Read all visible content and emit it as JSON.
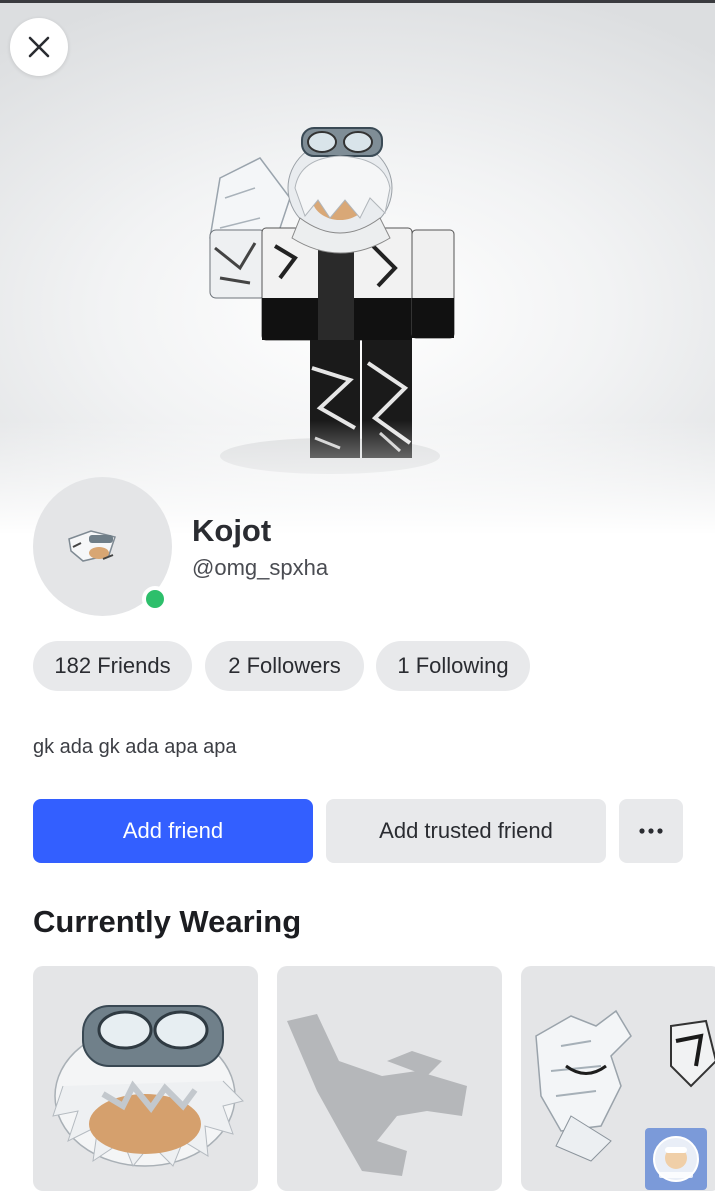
{
  "profile": {
    "display_name": "Kojot",
    "username": "@omg_spxha",
    "online": true,
    "bio": "gk ada gk ada apa apa"
  },
  "stats": {
    "friends": "182 Friends",
    "followers": "2 Followers",
    "following": "1 Following"
  },
  "actions": {
    "add_friend": "Add friend",
    "add_trusted_friend": "Add trusted friend",
    "more": "···"
  },
  "currently_wearing": {
    "title": "Currently Wearing",
    "items": [
      {
        "icon": "white-hair-goggles-accessory"
      },
      {
        "icon": "animation-pose-placeholder"
      },
      {
        "icon": "white-wings-accessory"
      }
    ]
  },
  "icons": {
    "close": "close-icon",
    "online": "online-status-dot",
    "more": "more-options-icon"
  },
  "colors": {
    "primary_button": "#335fff",
    "online_status": "#2dbf6b",
    "pill_background": "#e8e9eb"
  }
}
